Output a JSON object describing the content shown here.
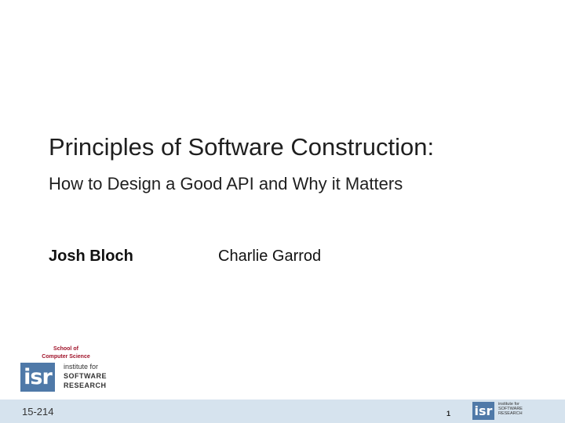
{
  "slide": {
    "title": "Principles of Software Construction:",
    "subtitle": "How to Design a Good API and Why it Matters",
    "authors": [
      "Josh Bloch",
      "Charlie Garrod"
    ]
  },
  "logo": {
    "school_line1": "School of",
    "school_line2": "Computer Science",
    "isr_mark": "isr",
    "isr_line1": "institute for",
    "isr_line2": "SOFTWARE",
    "isr_line3": "RESEARCH"
  },
  "footer": {
    "course": "15-214",
    "page_number": "1",
    "isr_mark": "isr",
    "isr_line1": "institute for",
    "isr_line2": "SOFTWARE",
    "isr_line3": "RESEARCH"
  },
  "colors": {
    "footer_bg": "#d6e3ee",
    "isr_blue": "#4f79a8",
    "scs_red": "#a0132a"
  }
}
